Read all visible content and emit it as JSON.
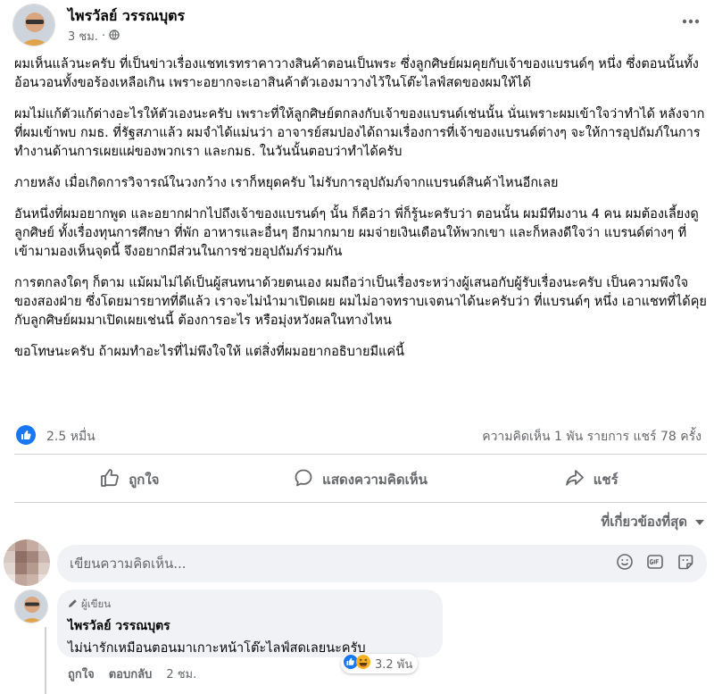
{
  "post": {
    "author": "ไพรวัลย์ วรรณบุตร",
    "time": "3 ชม.",
    "time_separator": "·",
    "paragraphs": [
      "ผมเห็นแล้วนะครับ ที่เป็นข่าวเรื่องแชทเรทราคาวางสินค้าตอนเป็นพระ ซึ่งลูกศิษย์ผมคุยกับเจ้าของแบรนด์ๆ หนึ่ง ซึ่งตอนนั้นทั้งอ้อนวอนทั้งขอร้องเหลือเกิน เพราะอยากจะเอาสินค้าตัวเองมาวางไว้ในโต๊ะไลฟ์สดของผมให้ได้",
      "ผมไม่แก้ตัวแก้ต่างอะไรให้ตัวเองนะครับ เพราะที่ให้ลูกศิษย์ตกลงกับเจ้าของแบรนด์เช่นนั้น นั่นเพราะผมเข้าใจว่าทำได้ หลังจากที่ผมเข้าพบ กมธ. ที่รัฐสภาแล้ว ผมจำได้แม่นว่า อาจารย์สมปองได้ถามเรื่องการที่เจ้าของแบรนด์ต่างๆ จะให้การอุปถัมภ์ในการทำงานด้านการเผยแผ่ของพวกเรา และกมธ. ในวันนั้นตอบว่าทำได้ครับ",
      "ภายหลัง เมื่อเกิดการวิจารณ์ในวงกว้าง เราก็หยุดครับ ไม่รับการอุปถัมภ์จากแบรนด์สินค้าไหนอีกเลย",
      "อันหนึ่งที่ผมอยากพูด และอยากฝากไปถึงเจ้าของแบรนด์ๆ นั้น ก็คือว่า พี่ก็รู้นะครับว่า ตอนนั้น ผมมีทีมงาน 4 คน ผมต้องเลี้ยงดูลูกศิษย์ ทั้งเรื่องทุนการศึกษา ที่พัก อาหารและอื่นๆ อีกมากมาย ผมจ่ายเงินเดือนให้พวกเขา และก็หลงดีใจว่า แบรนด์ต่างๆ ที่เข้ามามองเห็นจุดนี้ จึงอยากมีส่วนในการช่วยอุปถัมภ์ร่วมกัน",
      "การตกลงใดๆ ก็ตาม แม้ผมไม่ได้เป็นผู้สนทนาด้วยตนเอง ผมถือว่าเป็นเรื่องระหว่างผู้เสนอกับผู้รับเรื่องนะครับ เป็นความพึงใจของสองฝ่าย ซึ่งโดยมารยาทที่ดีแล้ว เราจะไม่นำมาเปิดเผย ผมไม่อาจทราบเจตนาได้นะครับว่า ที่แบรนด์ๆ หนึ่ง เอาแชทที่ได้คุยกับลูกศิษย์ผมมาเปิดเผยเช่นนี้ ต้องการอะไร หรือมุ่งหวังผลในทางไหน",
      "ขอโทษนะครับ ถ้าผมทำอะไรที่ไม่พึงใจให้ แต่สิ่งที่ผมอยากอธิบายมีแค่นี้"
    ],
    "reaction_count": "2.5 หมื่น",
    "comments_count": "ความคิดเห็น 1 พัน รายการ",
    "shares_count": "แชร์ 78 ครั้ง"
  },
  "actions": {
    "like": "ถูกใจ",
    "comment": "แสดงความคิดเห็น",
    "share": "แชร์"
  },
  "sort": {
    "label": "ที่เกี่ยวข้องที่สุด"
  },
  "comment_input": {
    "placeholder": "เขียนความคิดเห็น..."
  },
  "comment": {
    "badge": "ผู้เขียน",
    "author": "ไพรวัลย์ วรรณบุตร",
    "text": "ไม่น่ารักเหมือนตอนมาเกาะหน้าโต๊ะไลฟ์สดเลยนะครับ",
    "reaction_count": "3.2 พัน",
    "like_label": "ถูกใจ",
    "reply_label": "ตอบกลับ",
    "time": "2 ชม."
  },
  "colors": {
    "accent": "#1877f2",
    "secondary_text": "#65676b",
    "bubble_bg": "#f0f2f5",
    "divider": "#ced0d4"
  },
  "icons": {
    "more": "more-horizontal-icon",
    "audience": "globe-icon",
    "like": "thumbs-up-icon",
    "comment": "speech-bubble-icon",
    "share": "share-arrow-icon",
    "sort": "caret-down-icon",
    "emoji": "emoji-icon",
    "gif": "gif-icon",
    "sticker": "sticker-icon",
    "author_badge": "pencil-icon"
  }
}
